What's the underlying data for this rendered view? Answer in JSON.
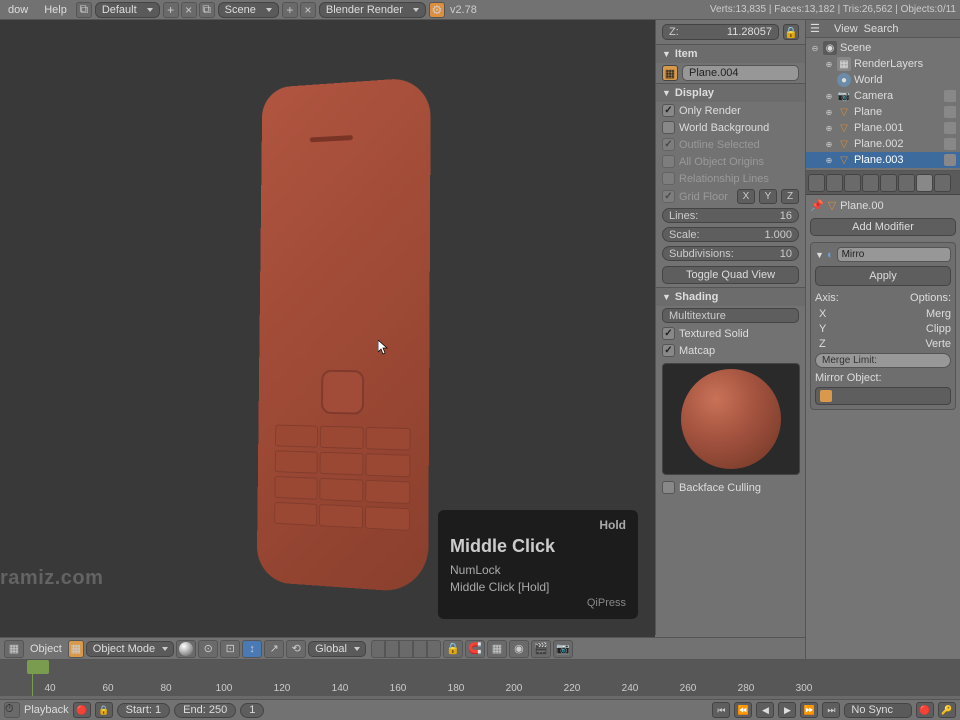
{
  "top": {
    "menu_window": "dow",
    "menu_help": "Help",
    "layout": "Default",
    "scene": "Scene",
    "renderer": "Blender Render",
    "version": "v2.78",
    "stats": "Verts:13,835 | Faces:13,182 | Tris:26,562 | Objects:0/11"
  },
  "outliner_hdr": {
    "view": "View",
    "search": "Search"
  },
  "outliner": {
    "scene": "Scene",
    "renderlayers": "RenderLayers",
    "world": "World",
    "camera": "Camera",
    "items": [
      "Plane",
      "Plane.001",
      "Plane.002",
      "Plane.003"
    ]
  },
  "z_field": {
    "label": "Z:",
    "value": "11.28057"
  },
  "panels": {
    "item": {
      "title": "Item",
      "name": "Plane.004"
    },
    "display": {
      "title": "Display",
      "only_render": "Only Render",
      "world_bg": "World Background",
      "outline_sel": "Outline Selected",
      "all_origins": "All Object Origins",
      "rel_lines": "Relationship Lines",
      "grid_floor": "Grid Floor",
      "lines": "Lines:",
      "lines_v": "16",
      "scale": "Scale:",
      "scale_v": "1.000",
      "subdiv": "Subdivisions:",
      "subdiv_v": "10",
      "toggle_quad": "Toggle Quad View"
    },
    "shading": {
      "title": "Shading",
      "method": "Multitexture",
      "textured_solid": "Textured Solid",
      "matcap": "Matcap",
      "backface": "Backface Culling"
    }
  },
  "properties": {
    "breadcrumb": "Plane.00",
    "add_modifier": "Add Modifier",
    "mirror": "Mirro",
    "apply": "Apply",
    "axis_label": "Axis:",
    "options_label": "Options:",
    "axes": {
      "x": "X",
      "y": "Y",
      "z": "Z"
    },
    "opts": {
      "merge": "Merg",
      "clip": "Clipp",
      "vert": "Verte"
    },
    "merge_limit": "Merge Limit:",
    "mirror_object": "Mirror Object:"
  },
  "vp_header": {
    "object_menu": "Object",
    "mode": "Object Mode",
    "orientation": "Global"
  },
  "timeline": {
    "ticks": [
      "40",
      "60",
      "80",
      "100",
      "120",
      "140",
      "160",
      "180",
      "200",
      "220",
      "240",
      "260",
      "280",
      "300"
    ],
    "playback": "Playback",
    "start_lbl": "Start:",
    "start_v": "1",
    "end_lbl": "End:",
    "end_v": "250",
    "cur_v": "1",
    "sync": "No Sync"
  },
  "tooltip": {
    "hold": "Hold",
    "title": "Middle Click",
    "numlock": "NumLock",
    "hold_line": "Middle Click [Hold]",
    "qipress": "QiPress"
  },
  "watermark": "ramiz.com"
}
